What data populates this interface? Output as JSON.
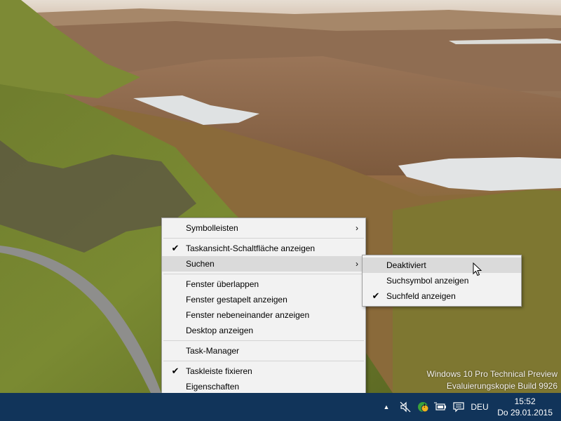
{
  "watermark": {
    "line1": "Windows 10 Pro Technical Preview",
    "line2": "Evaluierungskopie Build 9926"
  },
  "context_menu": {
    "items": [
      {
        "label": "Symbolleisten",
        "submenu": true
      },
      {
        "label": "Taskansicht-Schaltfläche anzeigen",
        "checked": true
      },
      {
        "label": "Suchen",
        "submenu": true,
        "highlighted": true
      },
      {
        "label": "Fenster überlappen"
      },
      {
        "label": "Fenster gestapelt anzeigen"
      },
      {
        "label": "Fenster nebeneinander anzeigen"
      },
      {
        "label": "Desktop anzeigen"
      },
      {
        "label": "Task-Manager"
      },
      {
        "label": "Taskleiste fixieren",
        "checked": true
      },
      {
        "label": "Eigenschaften"
      }
    ]
  },
  "search_submenu": {
    "items": [
      {
        "label": "Deaktiviert",
        "highlighted": true
      },
      {
        "label": "Suchsymbol anzeigen"
      },
      {
        "label": "Suchfeld anzeigen",
        "checked": true
      }
    ]
  },
  "glyphs": {
    "check": "✔",
    "arrow": "›",
    "tray_up": "▲"
  },
  "taskbar": {
    "language": "DEU",
    "time": "15:52",
    "date": "Do 29.01.2015",
    "badge": "!"
  },
  "colors": {
    "taskbar": "#11345a",
    "menu_bg": "#f2f2f2",
    "menu_highlight": "#dadada"
  }
}
